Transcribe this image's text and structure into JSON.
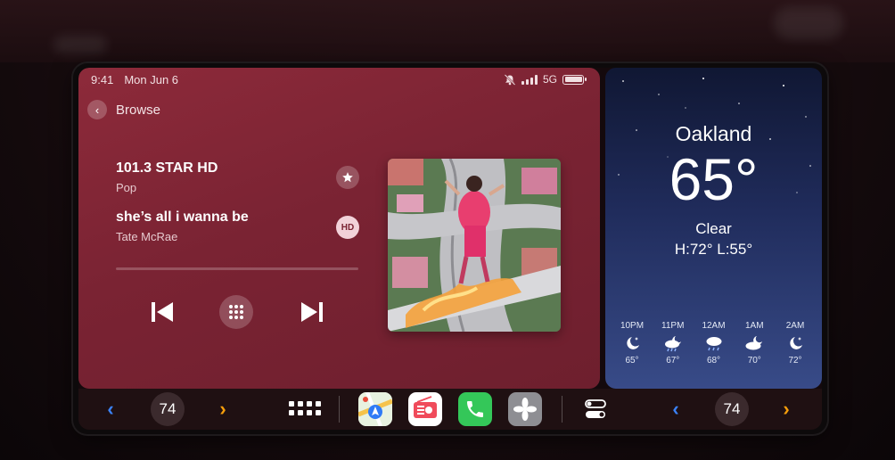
{
  "status_bar": {
    "time": "9:41",
    "date": "Mon Jun 6",
    "network": "5G"
  },
  "media": {
    "back_label": "Browse",
    "station_name": "101.3 STAR HD",
    "station_genre": "Pop",
    "track_title": "she’s all i wanna be",
    "track_artist": "Tate McRae",
    "favorite_icon": "star-icon",
    "hd_badge": "HD",
    "accent_color": "#7a2333"
  },
  "weather": {
    "city": "Oakland",
    "temperature": "65°",
    "condition": "Clear",
    "high_low": "H:72°  L:55°",
    "forecast": [
      {
        "hour": "10PM",
        "icon": "moon-stars-icon",
        "temp": "65°"
      },
      {
        "hour": "11PM",
        "icon": "cloud-moon-rain-icon",
        "temp": "67°"
      },
      {
        "hour": "12AM",
        "icon": "cloud-rain-icon",
        "temp": "68°"
      },
      {
        "hour": "1AM",
        "icon": "cloud-moon-icon",
        "temp": "70°"
      },
      {
        "hour": "2AM",
        "icon": "moon-stars-icon",
        "temp": "72°"
      }
    ]
  },
  "dock": {
    "left_temp": "74",
    "right_temp": "74",
    "apps": [
      "maps-icon",
      "radio-icon",
      "phone-icon",
      "fan-icon"
    ],
    "colors": {
      "chevron_blue": "#3b82f6",
      "chevron_orange": "#f59e0b",
      "phone_green": "#34c759"
    }
  }
}
